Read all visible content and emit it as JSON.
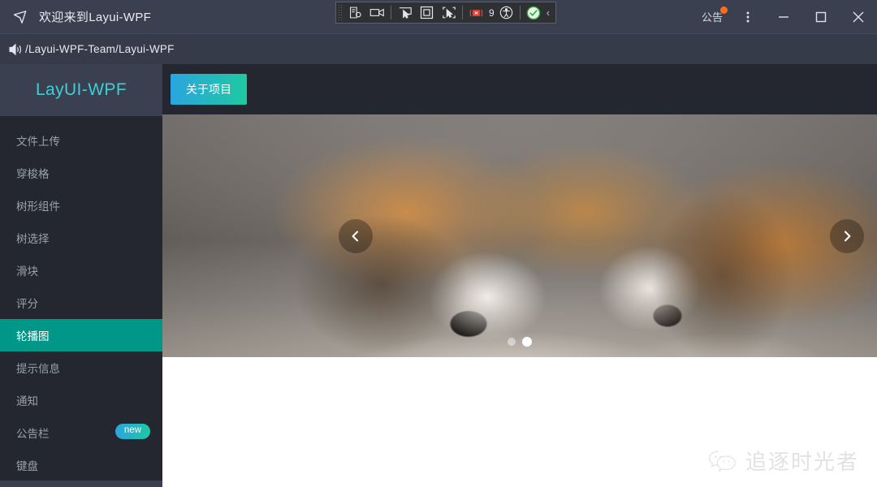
{
  "titlebar": {
    "logo_icon": "paper-plane-icon",
    "title": "欢迎来到Layui-WPF",
    "notice_label": "公告",
    "notice_dot": "notification-dot",
    "menu_icon": "kebab-menu-icon",
    "minimize_icon": "minimize-icon",
    "maximize_icon": "maximize-icon",
    "close_icon": "close-icon"
  },
  "capture_bar": {
    "grip": "drag-grip",
    "buttons": [
      {
        "name": "record-settings-icon"
      },
      {
        "name": "camcorder-icon"
      },
      {
        "name": "cursor-screen-icon"
      },
      {
        "name": "region-select-icon"
      },
      {
        "name": "cursor-capture-icon"
      },
      {
        "name": "stop-record-icon"
      },
      {
        "name": "accessibility-icon"
      },
      {
        "name": "check-circle-icon"
      }
    ],
    "count": "9",
    "collapse_icon": "chevron-left-icon"
  },
  "subbar": {
    "icon": "speaker-icon",
    "path": "/Layui-WPF-Team/Layui-WPF"
  },
  "sidebar": {
    "brand": "LayUI-WPF",
    "items": [
      {
        "label": "文件上传",
        "active": false,
        "badge": ""
      },
      {
        "label": "穿梭格",
        "active": false,
        "badge": ""
      },
      {
        "label": "树形组件",
        "active": false,
        "badge": ""
      },
      {
        "label": "树选择",
        "active": false,
        "badge": ""
      },
      {
        "label": "滑块",
        "active": false,
        "badge": ""
      },
      {
        "label": "评分",
        "active": false,
        "badge": ""
      },
      {
        "label": "轮播图",
        "active": true,
        "badge": ""
      },
      {
        "label": "提示信息",
        "active": false,
        "badge": ""
      },
      {
        "label": "通知",
        "active": false,
        "badge": ""
      },
      {
        "label": "公告栏",
        "active": false,
        "badge": "new"
      },
      {
        "label": "键盘",
        "active": false,
        "badge": ""
      }
    ]
  },
  "main": {
    "about_button": "关于项目",
    "carousel": {
      "prev_icon": "chevron-left-icon",
      "next_icon": "chevron-right-icon",
      "dots": [
        {
          "active": false
        },
        {
          "active": true
        }
      ],
      "image_alt": "两只睡着的比格犬"
    }
  },
  "watermark": {
    "icon": "wechat-icon",
    "text": "追逐时光者"
  },
  "colors": {
    "titlebar_bg": "#3b4050",
    "subbar_bg": "#363b49",
    "sidebar_bg": "#24272f",
    "accent_teal": "#009688",
    "brand_cyan": "#3ecfd6",
    "gradient_start": "#2aa5e0",
    "gradient_end": "#1fc9a0",
    "notice_dot": "#ff6b1a"
  }
}
